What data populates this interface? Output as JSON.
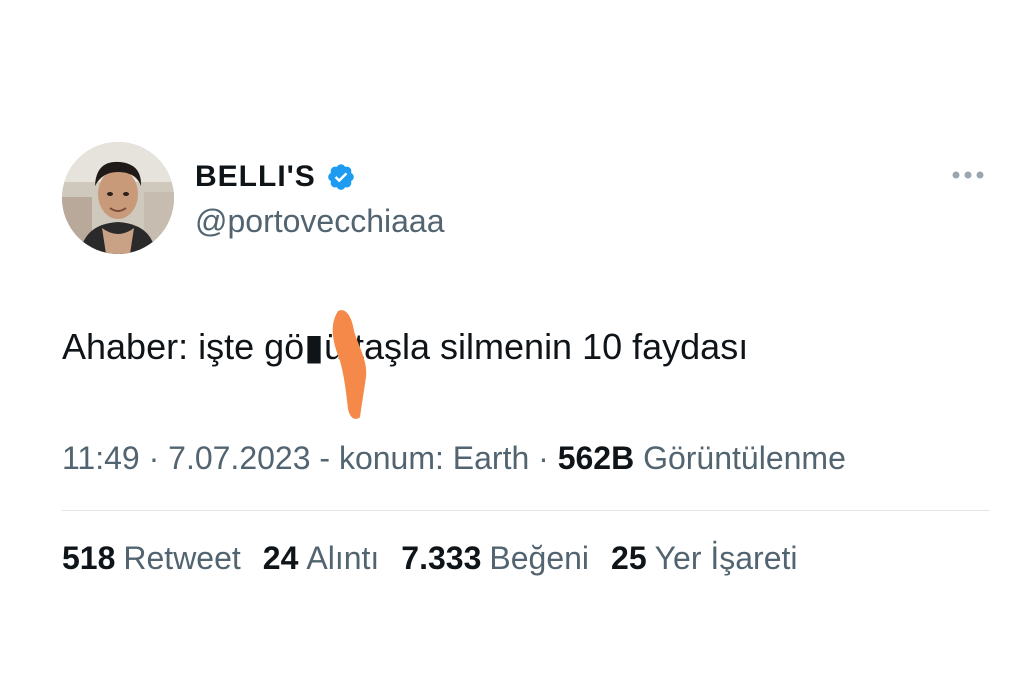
{
  "author": {
    "display_name": "BELLI'S",
    "handle": "@portovecchiaaa",
    "verified_icon": "verified-badge-icon"
  },
  "tweet": {
    "text": "Ahaber: işte gö▮ü taşla silmenin 10 faydası"
  },
  "meta": {
    "time": "11:49",
    "date": "7.07.2023",
    "location": "konum: Earth",
    "views_count": "562B",
    "views_label": "Görüntülenme"
  },
  "stats": {
    "retweets": "518",
    "retweets_label": "Retweet",
    "quotes": "24",
    "quotes_label": "Alıntı",
    "likes": "7.333",
    "likes_label": "Beğeni",
    "bookmarks": "25",
    "bookmarks_label": "Yer İşareti"
  },
  "colors": {
    "text_primary": "#0f1419",
    "text_secondary": "#536471",
    "verified": "#1d9bf0",
    "scribble": "#f5894a"
  }
}
